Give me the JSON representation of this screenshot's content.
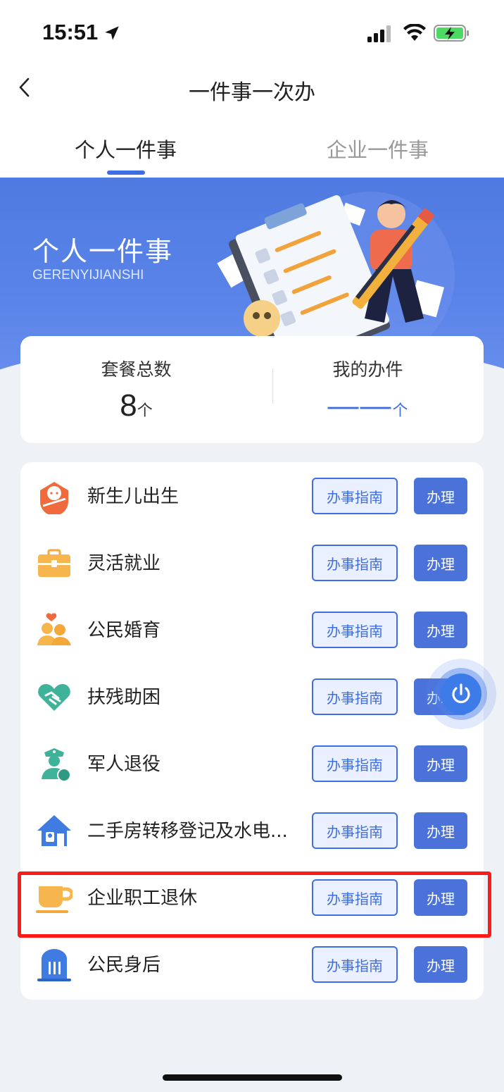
{
  "status_bar": {
    "time": "15:51"
  },
  "nav": {
    "title": "一件事一次办"
  },
  "tabs": [
    {
      "label": "个人一件事",
      "active": true
    },
    {
      "label": "企业一件事",
      "active": false
    }
  ],
  "hero": {
    "title": "个人一件事",
    "subtitle": "GERENYIJIANSHI"
  },
  "stats": {
    "total_label": "套餐总数",
    "total_value": "8",
    "total_unit": "个",
    "mine_label": "我的办件",
    "mine_value": "——",
    "mine_unit": "个"
  },
  "list": {
    "items": [
      {
        "label": "新生儿出生",
        "icon": "baby-icon",
        "guide_label": "办事指南",
        "action_label": "办理"
      },
      {
        "label": "灵活就业",
        "icon": "briefcase-icon",
        "guide_label": "办事指南",
        "action_label": "办理"
      },
      {
        "label": "公民婚育",
        "icon": "couple-icon",
        "guide_label": "办事指南",
        "action_label": "办理"
      },
      {
        "label": "扶残助困",
        "icon": "handshake-heart-icon",
        "guide_label": "办事指南",
        "action_label": "办理"
      },
      {
        "label": "军人退役",
        "icon": "soldier-icon",
        "guide_label": "办事指南",
        "action_label": "办理"
      },
      {
        "label": "二手房转移登记及水电...",
        "icon": "house-icon",
        "guide_label": "办事指南",
        "action_label": "办理"
      },
      {
        "label": "企业职工退休",
        "icon": "teacup-icon",
        "guide_label": "办事指南",
        "action_label": "办理",
        "highlighted": true
      },
      {
        "label": "公民身后",
        "icon": "memorial-icon",
        "guide_label": "办事指南",
        "action_label": "办理"
      }
    ]
  },
  "colors": {
    "accent": "#3f6ee0",
    "button_fill": "#4a72d8",
    "highlight": "#ff1a1a",
    "hero_bg": "#5a84e8"
  }
}
